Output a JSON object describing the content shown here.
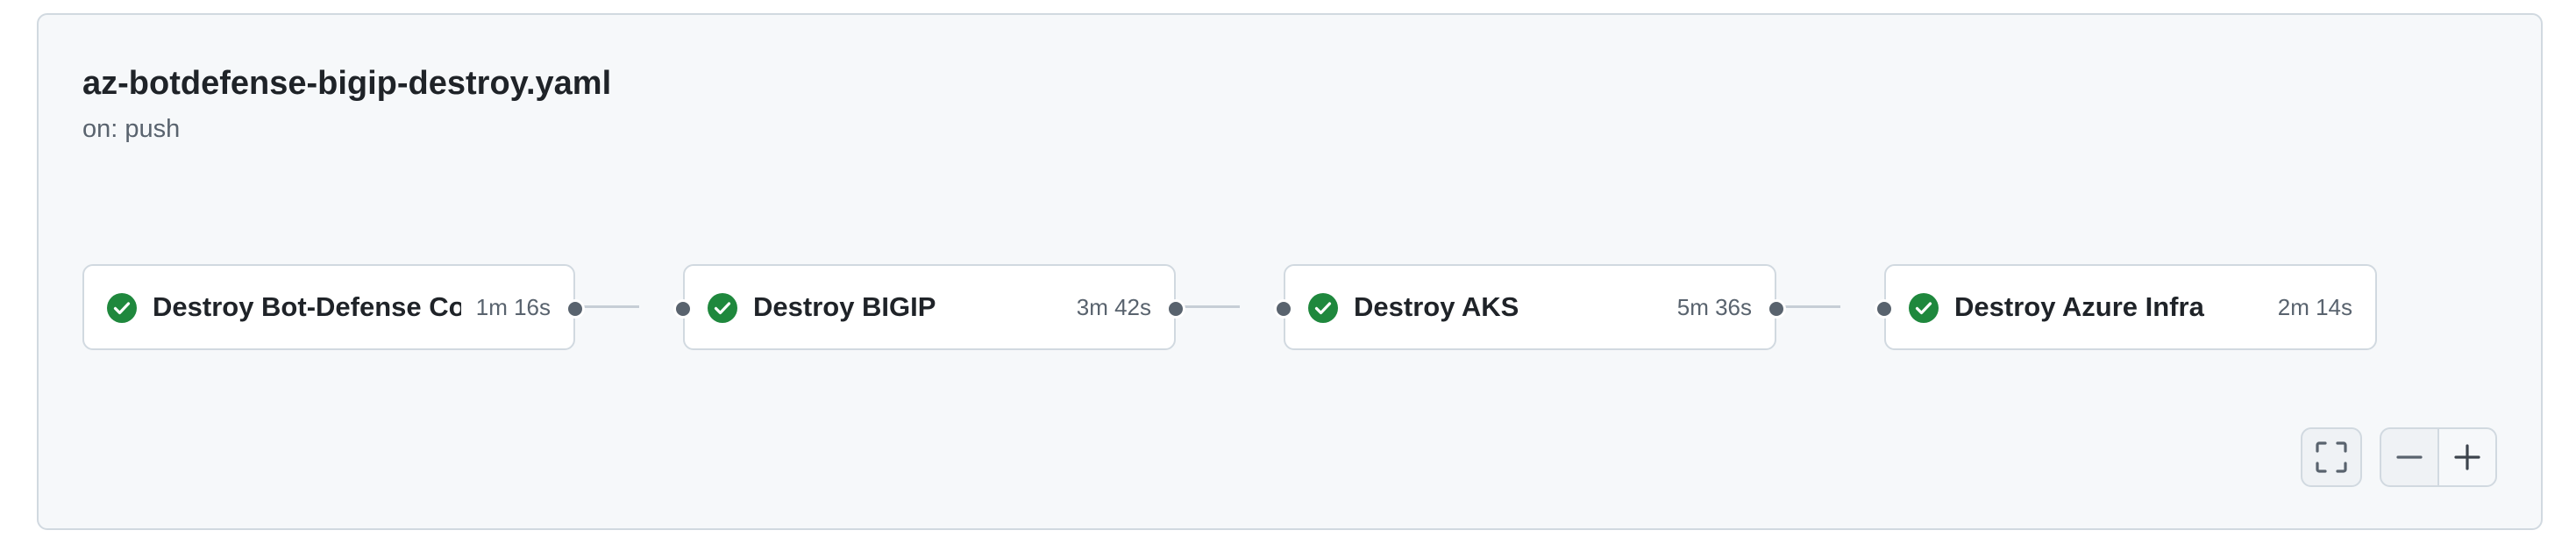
{
  "workflow": {
    "name": "az-botdefense-bigip-destroy.yaml",
    "trigger": "on: push"
  },
  "jobs": [
    {
      "name": "Destroy Bot-Defense Co...",
      "duration": "1m 16s",
      "status": "success"
    },
    {
      "name": "Destroy BIGIP",
      "duration": "3m 42s",
      "status": "success"
    },
    {
      "name": "Destroy AKS",
      "duration": "5m 36s",
      "status": "success"
    },
    {
      "name": "Destroy Azure Infra",
      "duration": "2m 14s",
      "status": "success"
    }
  ],
  "controls": {
    "fullscreen_icon": "fullscreen-icon",
    "zoom_out_icon": "minus-icon",
    "zoom_in_icon": "plus-icon"
  },
  "colors": {
    "success": "#1f883d",
    "panel_background": "#f6f8fa",
    "border": "#d1d9e0",
    "text_primary": "#1f2328",
    "text_secondary": "#59636e"
  }
}
